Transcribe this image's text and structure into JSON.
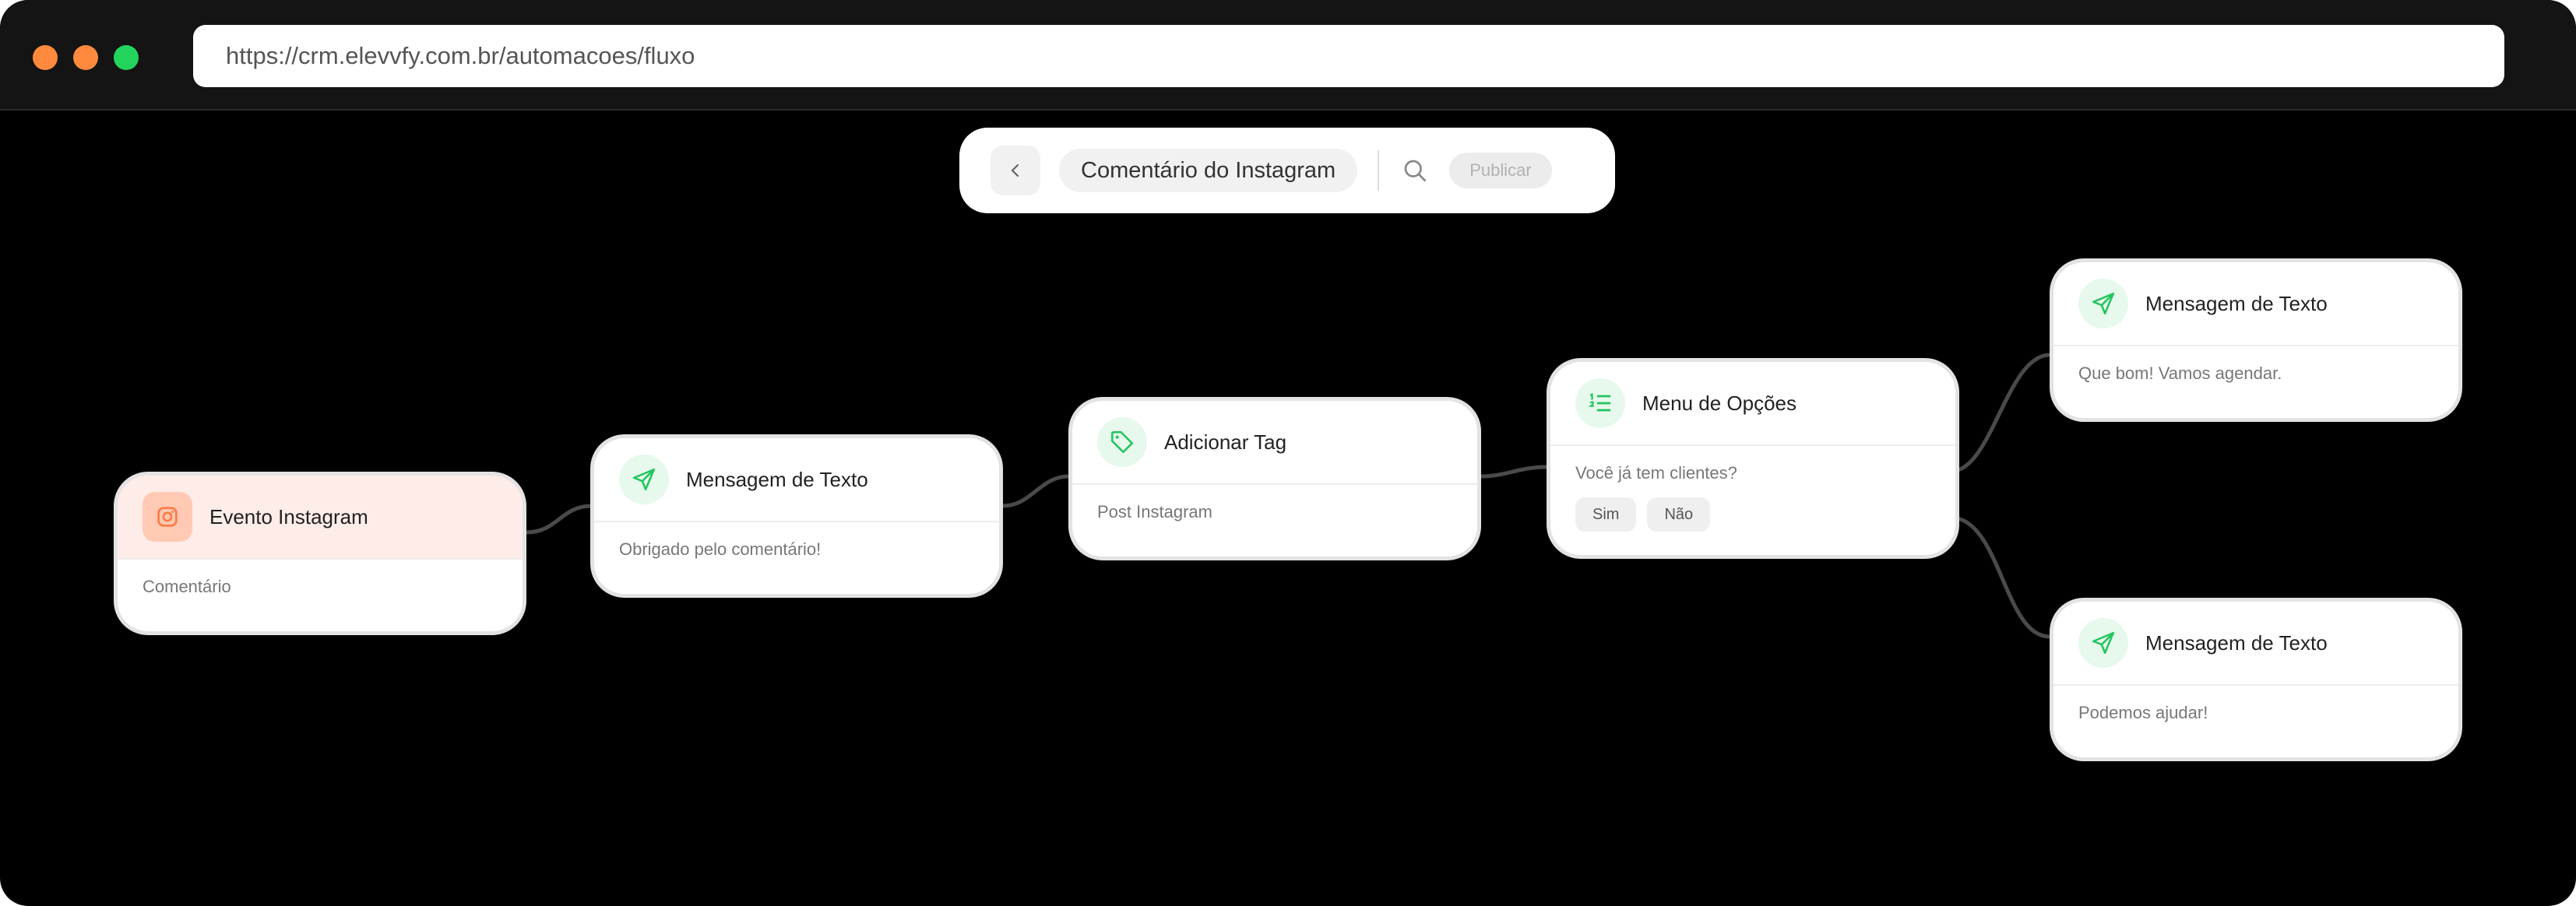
{
  "browser": {
    "url": "https://crm.elevvfy.com.br/automacoes/fluxo"
  },
  "toolbar": {
    "back_icon": "chevron-left-icon",
    "title": "Comentário do Instagram",
    "search_icon": "search-icon",
    "publish_label": "Publicar"
  },
  "colors": {
    "accent_green": "#22c55e",
    "trigger_orange": "#ff8a5b",
    "trigger_bg": "#fdece8",
    "canvas_bg": "#000000",
    "edge": "#4a4a4a"
  },
  "nodes": [
    {
      "id": "trigger",
      "icon": "instagram-icon",
      "title": "Evento Instagram",
      "body": "Comentário"
    },
    {
      "id": "msg1",
      "icon": "send-icon",
      "title": "Mensagem de Texto",
      "body": "Obrigado pelo comentário!"
    },
    {
      "id": "tag",
      "icon": "tag-icon",
      "title": "Adicionar Tag",
      "body": "Post Instagram"
    },
    {
      "id": "menu",
      "icon": "list-ordered-icon",
      "title": "Menu de Opções",
      "body": "Você já tem clientes?",
      "options": [
        "Sim",
        "Não"
      ]
    },
    {
      "id": "msg-yes",
      "icon": "send-icon",
      "title": "Mensagem de Texto",
      "body": "Que bom! Vamos agendar."
    },
    {
      "id": "msg-no",
      "icon": "send-icon",
      "title": "Mensagem de Texto",
      "body": "Podemos ajudar!"
    }
  ]
}
